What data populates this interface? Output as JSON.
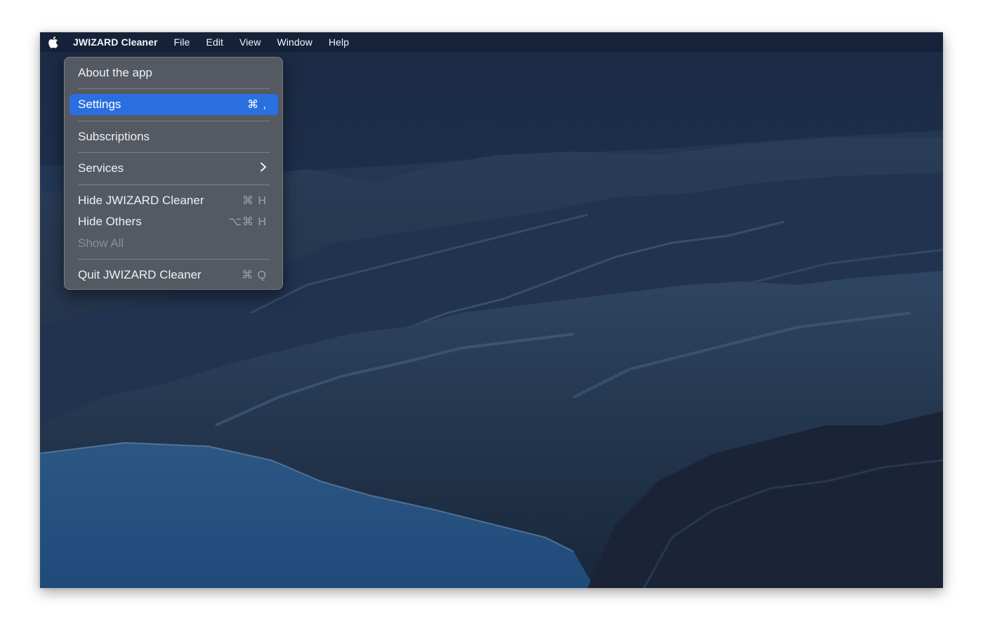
{
  "menubar": {
    "apple_icon": "apple-logo-icon",
    "items": [
      {
        "label": "JWIZARD Cleaner"
      },
      {
        "label": "File"
      },
      {
        "label": "Edit"
      },
      {
        "label": "View"
      },
      {
        "label": "Window"
      },
      {
        "label": "Help"
      }
    ]
  },
  "app_menu": {
    "items": [
      {
        "label": "About the app",
        "shortcut": ""
      },
      {
        "label": "Settings",
        "shortcut": "⌘ ,",
        "selected": true
      },
      {
        "label": "Subscriptions",
        "shortcut": ""
      },
      {
        "label": "Services",
        "submenu_icon": "chevron-right-icon"
      },
      {
        "label": "Hide JWIZARD Cleaner",
        "shortcut": "⌘ H"
      },
      {
        "label": "Hide Others",
        "shortcut": "⌥⌘ H"
      },
      {
        "label": "Show All",
        "shortcut": "",
        "disabled": true
      },
      {
        "label": "Quit JWIZARD Cleaner",
        "shortcut": "⌘ Q"
      }
    ]
  },
  "colors": {
    "selection": "#2a6fe0",
    "menu_bg": "#585c64",
    "wallpaper_sky": "#1f3350",
    "wallpaper_water": "#2a5480"
  }
}
